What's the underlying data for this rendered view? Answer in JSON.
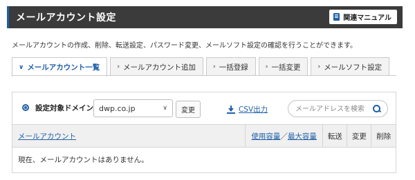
{
  "header": {
    "title": "メールアカウント設定",
    "manual_label": "関連マニュアル"
  },
  "description": "メールアカウントの作成、削除、転送設定、パスワード変更、メールソフト設定の確認を行うことができます。",
  "tabs": [
    {
      "label": "メールアカウント一覧",
      "active": true
    },
    {
      "label": "メールアカウント追加",
      "active": false
    },
    {
      "label": "一括登録",
      "active": false
    },
    {
      "label": "一括変更",
      "active": false
    },
    {
      "label": "メールソフト設定",
      "active": false
    }
  ],
  "filter": {
    "domain_label": "設定対象ドメイン",
    "domain_value": "dwp.co.jp",
    "change_label": "変更",
    "csv_label": "CSV出力",
    "search_placeholder": "メールアドレスを検索"
  },
  "table": {
    "headers": {
      "account": "メールアカウント",
      "usage": "使用容量",
      "separator": "／",
      "max": "最大容量",
      "forward": "転送",
      "change": "変更",
      "delete": "削除"
    },
    "empty_message": "現在、メールアカウントはありません。"
  },
  "colors": {
    "accent": "#1f5fa8",
    "header_bg": "#3b3b3b"
  }
}
